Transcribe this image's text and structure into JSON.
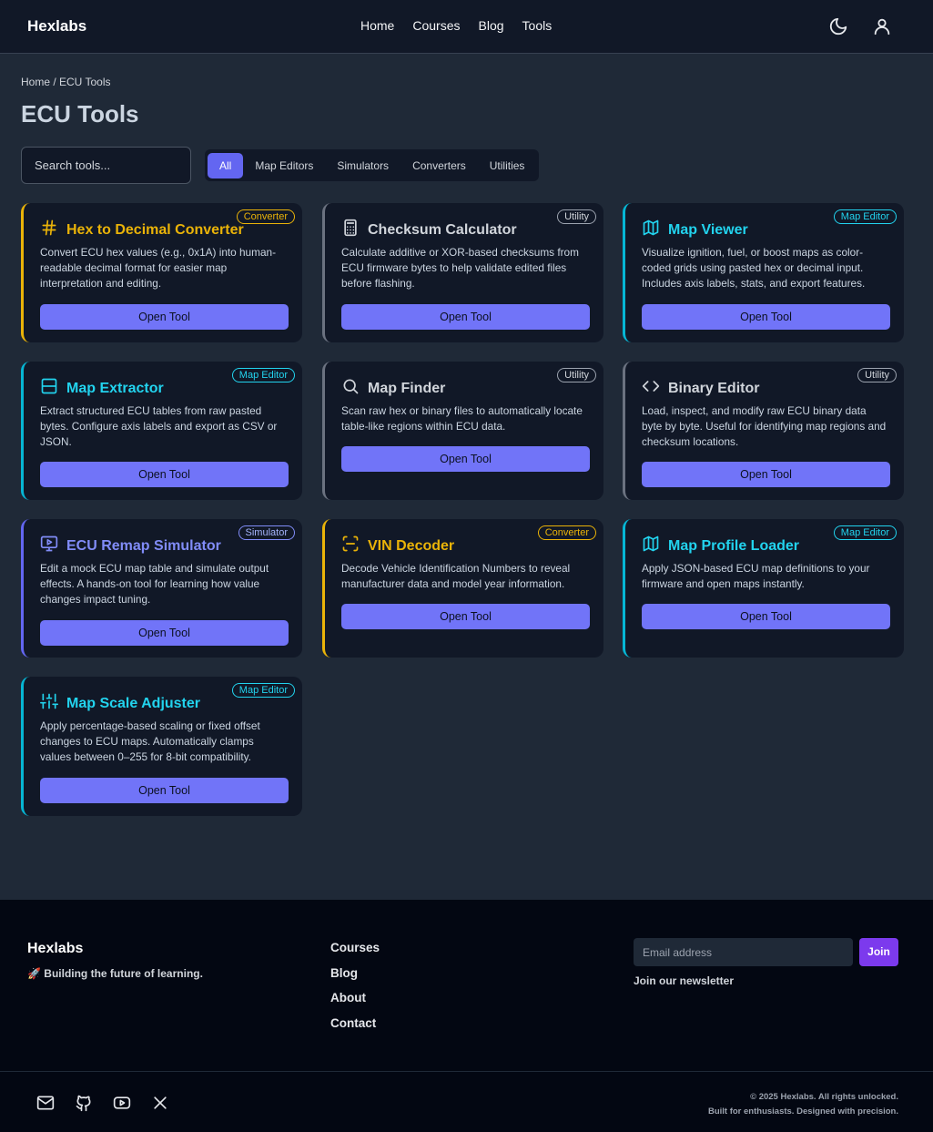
{
  "header": {
    "brand": "Hexlabs",
    "nav": [
      "Home",
      "Courses",
      "Blog",
      "Tools"
    ],
    "icons": [
      "moon-icon",
      "user-icon"
    ]
  },
  "breadcrumb": "Home / ECU Tools",
  "page_title": "ECU Tools",
  "search": {
    "placeholder": "Search tools..."
  },
  "filters": [
    {
      "label": "All",
      "active": true
    },
    {
      "label": "Map Editors",
      "active": false
    },
    {
      "label": "Simulators",
      "active": false
    },
    {
      "label": "Converters",
      "active": false
    },
    {
      "label": "Utilities",
      "active": false
    }
  ],
  "colors": {
    "converter": "#eab308",
    "utility": "#9ca3af",
    "map_editor": "#22d3ee",
    "simulator": "#818cf8",
    "button": "#7174f8",
    "join": "#7c3aed"
  },
  "tools": [
    {
      "title": "Hex to Decimal Converter",
      "badge": "Converter",
      "icon": "hash-icon",
      "description": "Convert ECU hex values (e.g., 0x1A) into human-readable decimal format for easier map interpretation and editing.",
      "button": "Open Tool"
    },
    {
      "title": "Checksum Calculator",
      "badge": "Utility",
      "icon": "calculator-icon",
      "description": "Calculate additive or XOR-based checksums from ECU firmware bytes to help validate edited files before flashing.",
      "button": "Open Tool"
    },
    {
      "title": "Map Viewer",
      "badge": "Map Editor",
      "icon": "map-icon",
      "description": "Visualize ignition, fuel, or boost maps as color-coded grids using pasted hex or decimal input. Includes axis labels, stats, and export features.",
      "button": "Open Tool"
    },
    {
      "title": "Map Extractor",
      "badge": "Map Editor",
      "icon": "table-icon",
      "description": "Extract structured ECU tables from raw pasted bytes. Configure axis labels and export as CSV or JSON.",
      "button": "Open Tool"
    },
    {
      "title": "Map Finder",
      "badge": "Utility",
      "icon": "search-icon",
      "description": "Scan raw hex or binary files to automatically locate table-like regions within ECU data.",
      "button": "Open Tool"
    },
    {
      "title": "Binary Editor",
      "badge": "Utility",
      "icon": "code-icon",
      "description": "Load, inspect, and modify raw ECU binary data byte by byte. Useful for identifying map regions and checksum locations.",
      "button": "Open Tool"
    },
    {
      "title": "ECU Remap Simulator",
      "badge": "Simulator",
      "icon": "monitor-play-icon",
      "description": "Edit a mock ECU map table and simulate output effects. A hands-on tool for learning how value changes impact tuning.",
      "button": "Open Tool"
    },
    {
      "title": "VIN Decoder",
      "badge": "Converter",
      "icon": "scan-icon",
      "description": "Decode Vehicle Identification Numbers to reveal manufacturer data and model year information.",
      "button": "Open Tool"
    },
    {
      "title": "Map Profile Loader",
      "badge": "Map Editor",
      "icon": "map-icon",
      "description": "Apply JSON-based ECU map definitions to your firmware and open maps instantly.",
      "button": "Open Tool"
    },
    {
      "title": "Map Scale Adjuster",
      "badge": "Map Editor",
      "icon": "sliders-icon",
      "description": "Apply percentage-based scaling or fixed offset changes to ECU maps. Automatically clamps values between 0–255 for 8-bit compatibility.",
      "button": "Open Tool"
    }
  ],
  "footer": {
    "brand": "Hexlabs",
    "tagline": "🚀 Building the future of learning.",
    "links": [
      "Courses",
      "Blog",
      "About",
      "Contact"
    ],
    "email_placeholder": "Email address",
    "join": "Join",
    "newsletter": "Join our newsletter",
    "social_icons": [
      "mail-icon",
      "github-icon",
      "youtube-icon",
      "x-icon"
    ],
    "copyright": "© 2025 Hexlabs. All rights unlocked.",
    "credit": "Built for enthusiasts. Designed with precision."
  }
}
